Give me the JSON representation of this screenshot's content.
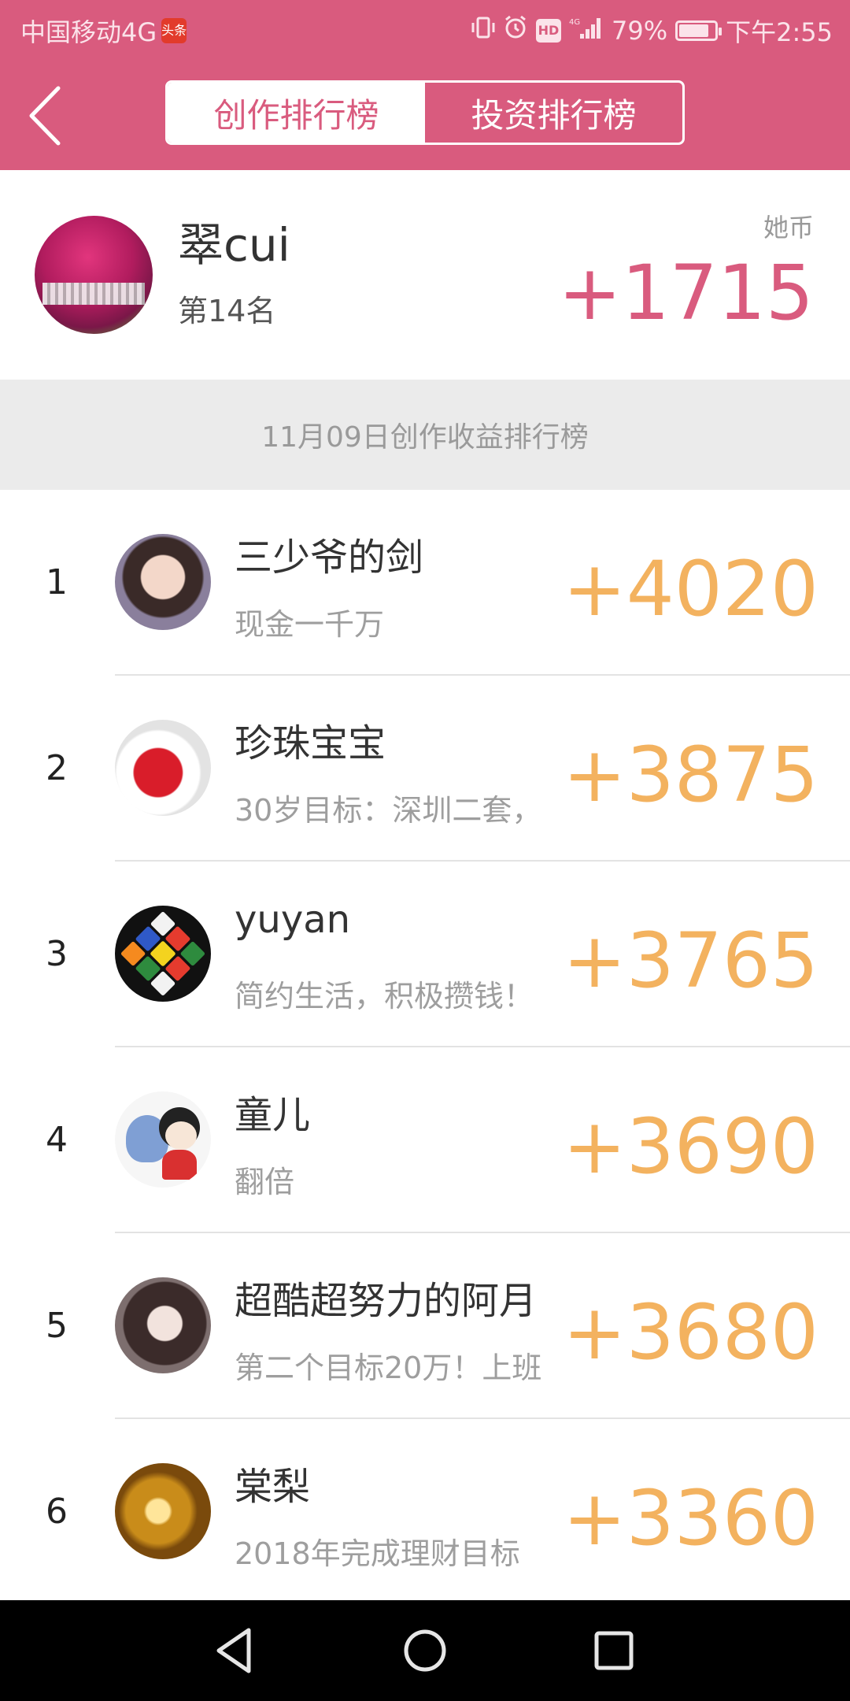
{
  "status_bar": {
    "carrier": "中国移动4G",
    "app_badge": "头条",
    "battery": "79%",
    "time": "下午2:55",
    "icons": [
      "vibrate-icon",
      "alarm-icon",
      "hd-icon",
      "signal-icon",
      "battery-icon"
    ],
    "hd_text": "HD",
    "battery_level": 0.79
  },
  "nav": {
    "back_icon": "chevron-left-icon",
    "tabs": [
      {
        "label": "创作排行榜",
        "active": true
      },
      {
        "label": "投资排行榜",
        "active": false
      }
    ]
  },
  "me": {
    "name": "翠cui",
    "rank_text": "第14名",
    "coin_label": "她币",
    "score": "+1715"
  },
  "leaderboard": {
    "title": "11月09日创作收益排行榜",
    "rows": [
      {
        "rank": "1",
        "name": "三少爷的剑",
        "motto": "现金一千万",
        "score": "+4020"
      },
      {
        "rank": "2",
        "name": "珍珠宝宝",
        "motto": "30岁目标：深圳二套，",
        "score": "+3875"
      },
      {
        "rank": "3",
        "name": "yuyan",
        "motto": "简约生活，积极攒钱！",
        "score": "+3765"
      },
      {
        "rank": "4",
        "name": "童儿",
        "motto": "翻倍",
        "score": "+3690"
      },
      {
        "rank": "5",
        "name": "超酷超努力的阿月",
        "motto": "第二个目标20万！上班",
        "score": "+3680"
      },
      {
        "rank": "6",
        "name": "棠梨",
        "motto": "2018年完成理财目标",
        "score": "+3360"
      }
    ]
  },
  "colors": {
    "brand_pink": "#d95b7e",
    "score_orange": "#f3b25f",
    "section_gray": "#ebebeb"
  },
  "system_nav": {
    "icons": [
      "back-triangle-icon",
      "home-circle-icon",
      "recents-square-icon"
    ]
  }
}
